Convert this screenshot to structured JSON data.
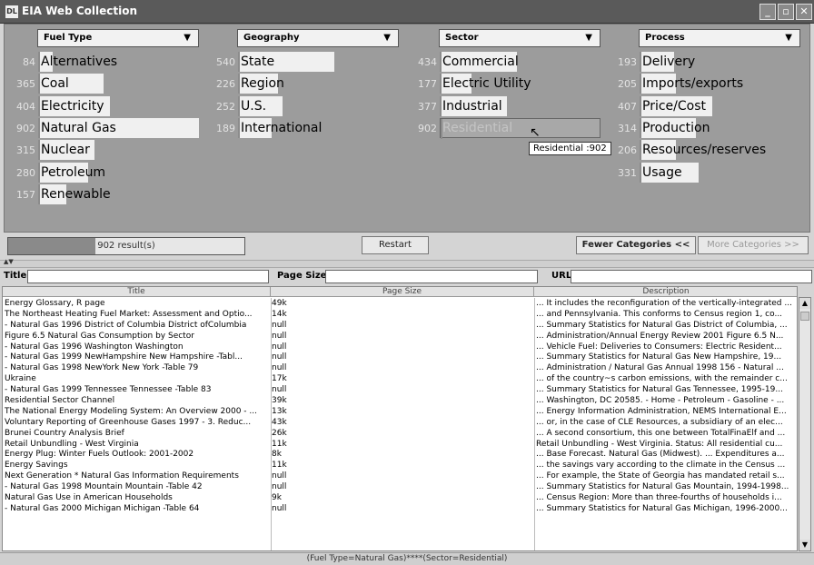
{
  "window": {
    "logo": "DL",
    "title": "EIA Web Collection"
  },
  "facets": [
    {
      "label": "Fuel Type",
      "items": [
        {
          "count": "84",
          "label": "Alternatives",
          "value": 84
        },
        {
          "count": "365",
          "label": "Coal",
          "value": 365
        },
        {
          "count": "404",
          "label": "Electricity",
          "value": 404
        },
        {
          "count": "902",
          "label": "Natural Gas",
          "value": 902
        },
        {
          "count": "315",
          "label": "Nuclear",
          "value": 315
        },
        {
          "count": "280",
          "label": "Petroleum",
          "value": 280
        },
        {
          "count": "157",
          "label": "Renewable",
          "value": 157
        }
      ]
    },
    {
      "label": "Geography",
      "items": [
        {
          "count": "540",
          "label": "State",
          "value": 540
        },
        {
          "count": "226",
          "label": "Region",
          "value": 226
        },
        {
          "count": "252",
          "label": "U.S.",
          "value": 252
        },
        {
          "count": "189",
          "label": "International",
          "value": 189
        }
      ]
    },
    {
      "label": "Sector",
      "items": [
        {
          "count": "434",
          "label": "Commercial",
          "value": 434
        },
        {
          "count": "177",
          "label": "Electric Utility",
          "value": 177
        },
        {
          "count": "377",
          "label": "Industrial",
          "value": 377
        },
        {
          "count": "902",
          "label": "Residential",
          "value": 902,
          "selected": true
        }
      ]
    },
    {
      "label": "Process",
      "items": [
        {
          "count": "193",
          "label": "Delivery",
          "value": 193
        },
        {
          "count": "205",
          "label": "Imports/exports",
          "value": 205
        },
        {
          "count": "407",
          "label": "Price/Cost",
          "value": 407
        },
        {
          "count": "314",
          "label": "Production",
          "value": 314
        },
        {
          "count": "206",
          "label": "Resources/reserves",
          "value": 206
        },
        {
          "count": "331",
          "label": "Usage",
          "value": 331
        }
      ]
    }
  ],
  "tooltip": "Residential :902",
  "controls": {
    "results": "902 result(s)",
    "results_fraction": 0.37,
    "restart": "Restart",
    "fewer": "Fewer Categories <<",
    "more": "More Categories >>"
  },
  "filters": {
    "title_label": "Title:",
    "pagesize_label": "Page Size:",
    "url_label": "URL:"
  },
  "table": {
    "headers": [
      "Title",
      "Page Size",
      "Description"
    ],
    "rows": [
      [
        "Energy Glossary, R page",
        "49k",
        "... It includes the reconfiguration of the vertically-integrated ..."
      ],
      [
        "The Northeast Heating Fuel Market: Assessment and Optio...",
        "14k",
        "... and Pennsylvania. This conforms to Census region 1, co..."
      ],
      [
        "- Natural Gas 1996 District of Columbia District ofColumbia",
        "null",
        "... Summary Statistics for Natural Gas District of Columbia, ..."
      ],
      [
        "Figure 6.5 Natural Gas Consumption by Sector",
        "null",
        "... Administration/Annual Energy Review 2001 Figure 6.5 N..."
      ],
      [
        "- Natural Gas 1996 Washington Washington",
        "null",
        "... Vehicle Fuel: Deliveries to Consumers: Electric Resident..."
      ],
      [
        "- Natural Gas 1999 NewHampshire New Hampshire -Tabl...",
        "null",
        "... Summary Statistics for Natural Gas New Hampshire, 19..."
      ],
      [
        "- Natural Gas 1998 NewYork New York -Table 79",
        "null",
        "... Administration / Natural Gas Annual 1998 156 - Natural ..."
      ],
      [
        "Ukraine",
        "17k",
        "... of the country~s carbon emissions, with the remainder c..."
      ],
      [
        "- Natural Gas 1999 Tennessee Tennessee -Table 83",
        "null",
        "... Summary Statistics for Natural Gas Tennessee, 1995-19..."
      ],
      [
        "Residential Sector Channel",
        "39k",
        "... Washington, DC 20585. - Home - Petroleum - Gasoline - ..."
      ],
      [
        "The National Energy Modeling System: An Overview 2000 - ...",
        "13k",
        "... Energy Information Administration, NEMS International E..."
      ],
      [
        "Voluntary Reporting of Greenhouse Gases 1997 - 3. Reduc...",
        "43k",
        "... or, in the case of CLE Resources, a subsidiary of an elec..."
      ],
      [
        "Brunei Country Analysis Brief",
        "26k",
        "... A second consortium, this one between TotalFinaElf and ..."
      ],
      [
        "Retail Unbundling - West Virginia",
        "11k",
        "Retail Unbundling - West Virginia. Status: All residential cu..."
      ],
      [
        "Energy Plug: Winter Fuels Outlook: 2001-2002",
        "8k",
        "... Base Forecast. Natural Gas (Midwest). ... Expenditures a..."
      ],
      [
        "Energy Savings",
        "11k",
        "... the savings vary according to the climate in the Census ..."
      ],
      [
        "Next Generation * Natural Gas Information Requirements",
        "null",
        "... For example, the State of Georgia has mandated retail s..."
      ],
      [
        "- Natural Gas 1998 Mountain Mountain -Table 42",
        "null",
        "... Summary Statistics for Natural Gas Mountain, 1994-1998..."
      ],
      [
        "Natural Gas Use in American Households",
        "9k",
        "... Census Region: More than three-fourths of households i..."
      ],
      [
        "- Natural Gas 2000 Michigan Michigan -Table 64",
        "null",
        "... Summary Statistics for Natural Gas Michigan, 1996-2000..."
      ]
    ]
  },
  "status": "(Fuel Type=Natural Gas)****(Sector=Residential)"
}
